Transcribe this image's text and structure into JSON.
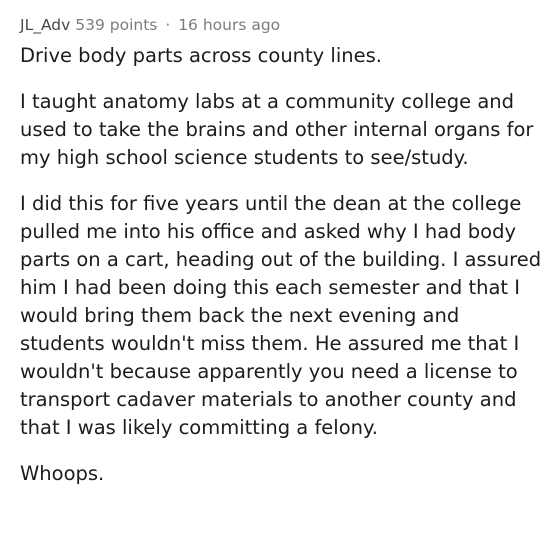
{
  "comment": {
    "author": "JL_Adv",
    "points": "539 points",
    "separator": "·",
    "time": "16 hours ago",
    "paragraphs": [
      "Drive body parts across county lines.",
      "I taught anatomy labs at a community college and used to take the brains and other internal organs for my high school science students to see/study.",
      "I did this for five years until the dean at the college pulled me into his office and asked why I had body parts on a cart, heading out of the building. I assured him I had been doing this each semester and that I would bring them back the next evening and students wouldn't miss them. He assured me that I wouldn't because apparently you need a license to transport cadaver materials to another county and that I was likely committing a felony.",
      "Whoops."
    ]
  }
}
